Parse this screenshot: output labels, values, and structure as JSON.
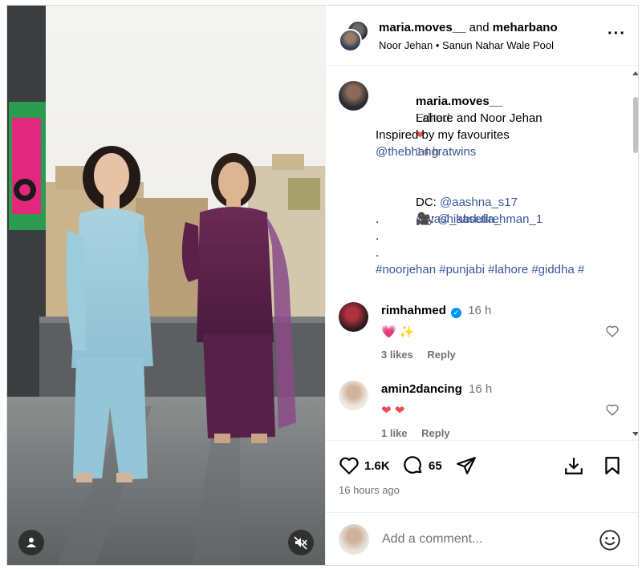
{
  "header": {
    "user1": "maria.moves__",
    "and": "and",
    "user2": "meharbano",
    "audio": "Noor Jehan",
    "separator": "•",
    "location": "Sanun Nahar Wale Pool",
    "more_icon": "more-options-icon"
  },
  "caption": {
    "user": "maria.moves__",
    "edited": "Edited",
    "dot": "•",
    "time": "14 h",
    "line1": "Lahore and Noor Jehan",
    "line1_emoji": "❤",
    "line2": "Inspired by my favourites",
    "line3": "@thebhangratwins",
    "dc_label": "DC: ",
    "dc1": "@aashna_s17",
    "dc2": "@yashikasetia_",
    "cam_label": "🎥: ",
    "cam_user": "@_abdullrehman_1",
    "dots": [
      ".",
      ".",
      "."
    ],
    "hashtags": "#noorjehan #punjabi #lahore #giddha #"
  },
  "comments": [
    {
      "user": "rimhahmed",
      "verified": true,
      "time": "16 h",
      "text": "💗 ✨",
      "likes": "3 likes",
      "reply": "Reply"
    },
    {
      "user": "amin2dancing",
      "verified": false,
      "time": "16 h",
      "text": "❤ ❤",
      "likes": "1 like",
      "reply": "Reply"
    }
  ],
  "actions": {
    "likes": "1.6K",
    "comments": "65",
    "time_ago": "16 hours ago"
  },
  "add_comment": {
    "placeholder": "Add a comment..."
  },
  "colors": {
    "heart": "#ed4956",
    "link": "#385898",
    "muted": "#737373",
    "verified": "#0095f6"
  }
}
